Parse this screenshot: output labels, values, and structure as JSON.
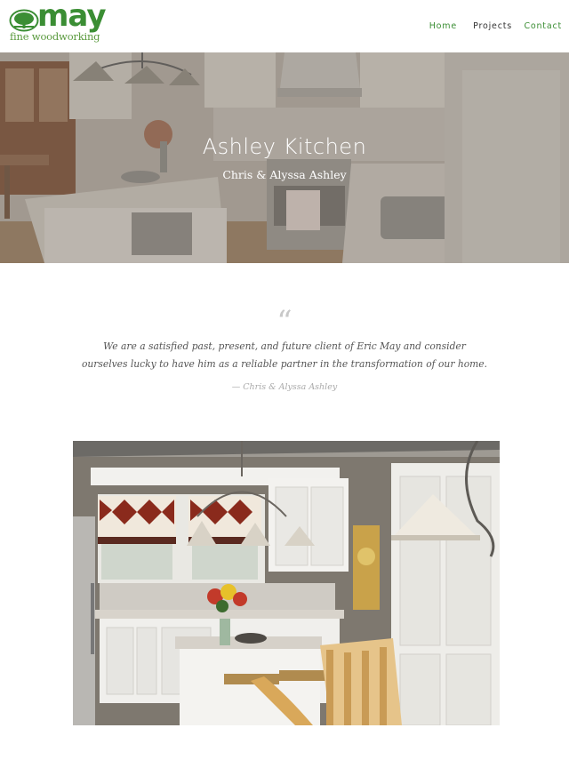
{
  "brand": {
    "name": "may",
    "tagline": "fine woodworking",
    "colors": {
      "green": "#3b8e34"
    }
  },
  "nav": {
    "items": [
      {
        "label": "Home"
      },
      {
        "label": "Projects"
      },
      {
        "label": "Contact"
      }
    ]
  },
  "hero": {
    "title": "Ashley Kitchen",
    "subtitle": "Chris & Alyssa Ashley"
  },
  "testimonial": {
    "mark": "“",
    "text": "We are a satisfied past, present, and future client of Eric May and consider ourselves lucky to have him as a reliable partner in the transformation of our home.",
    "author": "— Chris & Alyssa Ashley"
  },
  "icons": {
    "logo": "tree-icon",
    "quote": "quote-icon"
  }
}
